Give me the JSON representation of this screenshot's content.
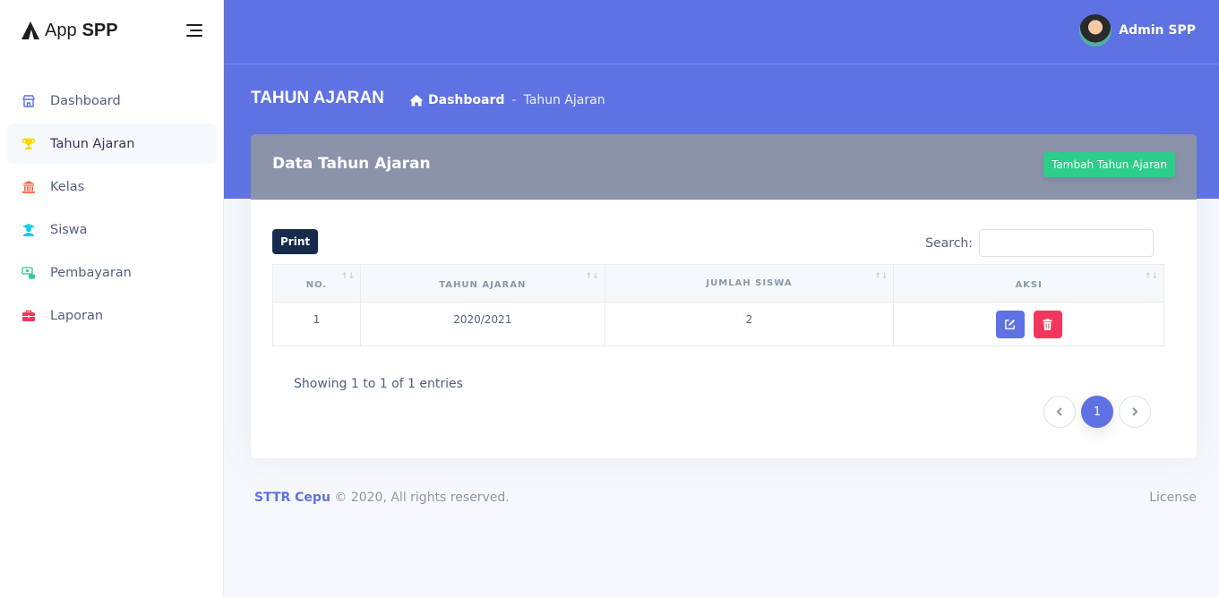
{
  "brand": {
    "app": "App",
    "name": "SPP"
  },
  "sidebar": {
    "items": [
      {
        "label": "Dashboard",
        "icon": "shop-icon",
        "color": "#5e72e4"
      },
      {
        "label": "Tahun Ajaran",
        "icon": "trophy-icon",
        "color": "#ffd600",
        "active": true
      },
      {
        "label": "Kelas",
        "icon": "bank-icon",
        "color": "#fb6340"
      },
      {
        "label": "Siswa",
        "icon": "student-icon",
        "color": "#11cdef"
      },
      {
        "label": "Pembayaran",
        "icon": "money-icon",
        "color": "#2dce89"
      },
      {
        "label": "Laporan",
        "icon": "briefcase-icon",
        "color": "#f5365c"
      }
    ]
  },
  "header": {
    "user_name": "Admin SPP"
  },
  "page": {
    "title": "TAHUN AJARAN",
    "breadcrumb": {
      "home": "Dashboard",
      "separator": "-",
      "current": "Tahun Ajaran"
    }
  },
  "card": {
    "title": "Data Tahun Ajaran",
    "add_button": "Tambah Tahun Ajaran",
    "print_button": "Print",
    "search_label": "Search:",
    "search_value": ""
  },
  "table": {
    "columns": [
      "NO.",
      "TAHUN AJARAN",
      "JUMLAH SISWA",
      "AKSI"
    ],
    "rows": [
      {
        "no": "1",
        "tahun_ajaran": "2020/2021",
        "jumlah_siswa": "2"
      }
    ]
  },
  "pagination": {
    "info": "Showing 1 to 1 of 1 entries",
    "current_page": "1"
  },
  "footer": {
    "brand": "STTR Cepu",
    "copyright": "© 2020, All rights reserved.",
    "license": "License"
  },
  "colors": {
    "primary": "#5e72e4",
    "success": "#2dce89",
    "danger": "#f5365c",
    "dark": "#172b4d",
    "header_card": "#8a93a9"
  }
}
